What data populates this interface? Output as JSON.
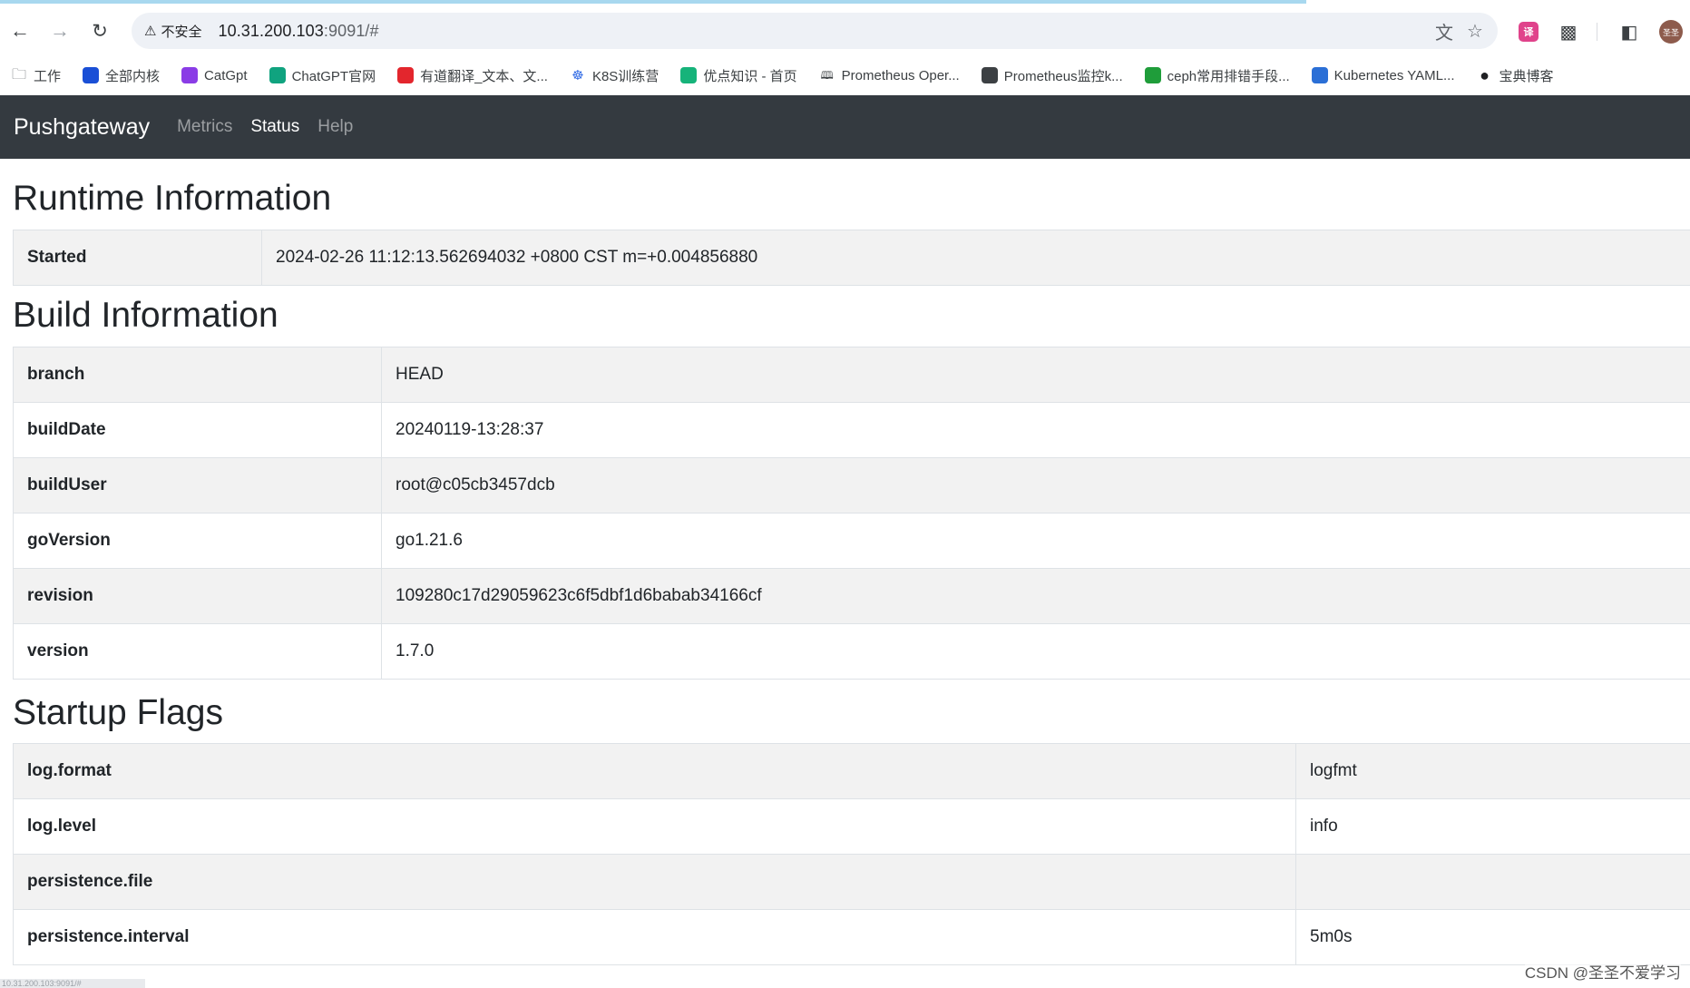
{
  "browser": {
    "security_label": "不安全",
    "url_host": "10.31.200.103",
    "url_rest": ":9091/#",
    "bookmarks": [
      {
        "label": "工作",
        "icon": "folder-icon",
        "color": "#5f6368"
      },
      {
        "label": "全部内核",
        "icon": "fr-icon",
        "color": "#1a4fd6"
      },
      {
        "label": "CatGpt",
        "icon": "catgpt-icon",
        "color": "#8a3ce6"
      },
      {
        "label": "ChatGPT官网",
        "icon": "chatgpt-icon",
        "color": "#10a37f"
      },
      {
        "label": "有道翻译_文本、文...",
        "icon": "youdao-icon",
        "color": "#e3262d"
      },
      {
        "label": "K8S训练营",
        "icon": "k8s-icon",
        "color": "#326ce5"
      },
      {
        "label": "优点知识 - 首页",
        "icon": "youdian-icon",
        "color": "#16b37a"
      },
      {
        "label": "Prometheus Oper...",
        "icon": "book-icon",
        "color": "#3c4043"
      },
      {
        "label": "Prometheus监控k...",
        "icon": "prometheus-icon",
        "color": "#3c4043"
      },
      {
        "label": "ceph常用排错手段...",
        "icon": "ceph-icon",
        "color": "#1f9d3a"
      },
      {
        "label": "Kubernetes YAML...",
        "icon": "kube-yaml-icon",
        "color": "#2b6fd6"
      },
      {
        "label": "宝典博客",
        "icon": "globe-icon",
        "color": "#202124"
      }
    ],
    "status_url": "10.31.200.103:9091/#"
  },
  "app": {
    "brand": "Pushgateway",
    "nav": [
      {
        "label": "Metrics",
        "active": false
      },
      {
        "label": "Status",
        "active": true
      },
      {
        "label": "Help",
        "active": false
      }
    ]
  },
  "runtime": {
    "title": "Runtime Information",
    "rows": [
      {
        "key": "Started",
        "value": "2024-02-26 11:12:13.562694032 +0800 CST m=+0.004856880"
      }
    ]
  },
  "build": {
    "title": "Build Information",
    "rows": [
      {
        "key": "branch",
        "value": "HEAD"
      },
      {
        "key": "buildDate",
        "value": "20240119-13:28:37"
      },
      {
        "key": "buildUser",
        "value": "root@c05cb3457dcb"
      },
      {
        "key": "goVersion",
        "value": "go1.21.6"
      },
      {
        "key": "revision",
        "value": "109280c17d29059623c6f5dbf1d6babab34166cf"
      },
      {
        "key": "version",
        "value": "1.7.0"
      }
    ]
  },
  "flags": {
    "title": "Startup Flags",
    "rows": [
      {
        "key": "log.format",
        "value": "logfmt"
      },
      {
        "key": "log.level",
        "value": "info"
      },
      {
        "key": "persistence.file",
        "value": ""
      },
      {
        "key": "persistence.interval",
        "value": "5m0s"
      }
    ]
  },
  "watermark": "CSDN @圣圣不爱学习",
  "colors": {
    "navbar": "#343a40",
    "stripe": "#f2f2f2",
    "border": "#dee2e6"
  }
}
